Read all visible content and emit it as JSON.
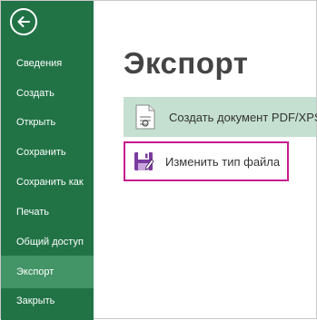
{
  "sidebar": {
    "back_icon": "back-arrow-icon",
    "items": [
      {
        "label": "Сведения"
      },
      {
        "label": "Создать"
      },
      {
        "label": "Открыть"
      },
      {
        "label": "Сохранить"
      },
      {
        "label": "Сохранить как"
      },
      {
        "label": "Печать"
      },
      {
        "label": "Общий доступ"
      },
      {
        "label": "Экспорт",
        "active": true
      },
      {
        "label": "Закрыть"
      }
    ]
  },
  "main": {
    "title": "Экспорт",
    "options": [
      {
        "label": "Создать документ PDF/XPS",
        "icon": "pdf-document-icon",
        "selected": true
      },
      {
        "label": "Изменить тип файла",
        "icon": "change-file-type-icon",
        "highlighted": true
      }
    ]
  },
  "colors": {
    "sidebar_bg": "#217346",
    "sidebar_active": "#439467",
    "option_selected_bg": "#c5e0d0",
    "highlight_border": "#c61a8e"
  }
}
